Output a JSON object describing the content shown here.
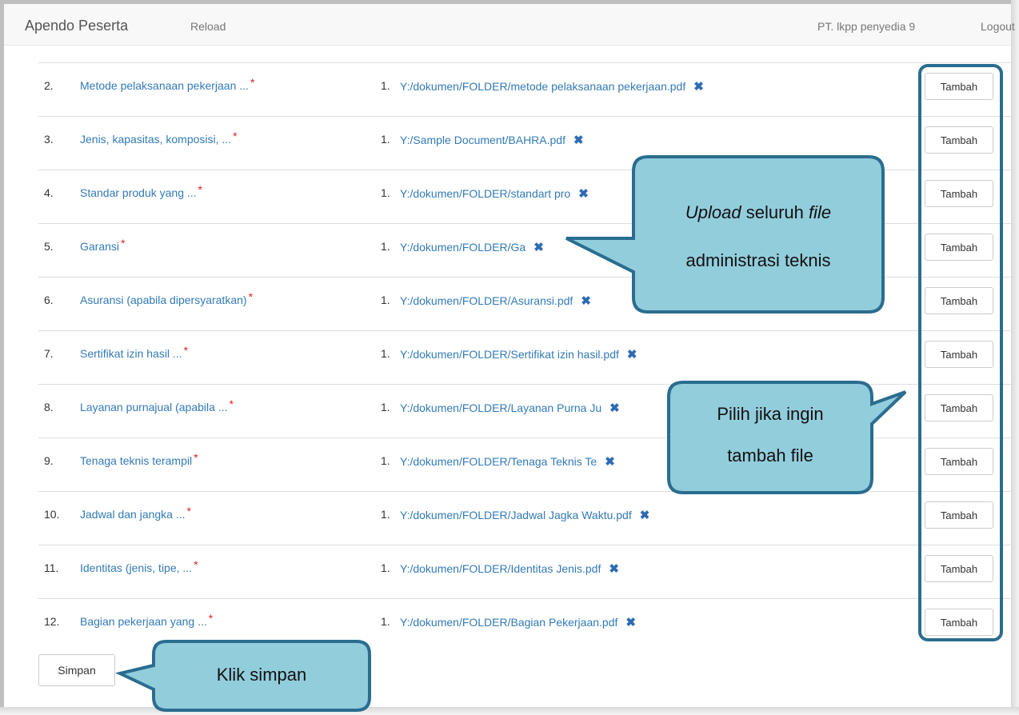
{
  "navbar": {
    "brand": "Apendo Peserta",
    "reload": "Reload",
    "user": "PT. lkpp penyedia 9",
    "logout": "Logout"
  },
  "rows": [
    {
      "num": "2.",
      "doc": "Metode pelaksanaan pekerjaan ...",
      "required": "*",
      "file_num": "1.",
      "file": "Y:/dokumen/FOLDER/metode pelaksanaan pekerjaan.pdf",
      "button": "Tambah"
    },
    {
      "num": "3.",
      "doc": "Jenis, kapasitas, komposisi, ...",
      "required": "*",
      "file_num": "1.",
      "file": "Y:/Sample Document/BAHRA.pdf",
      "button": "Tambah"
    },
    {
      "num": "4.",
      "doc": "Standar produk yang ...",
      "required": "*",
      "file_num": "1.",
      "file": "Y:/dokumen/FOLDER/standart pro",
      "button": "Tambah"
    },
    {
      "num": "5.",
      "doc": "Garansi",
      "required": "*",
      "file_num": "1.",
      "file": "Y:/dokumen/FOLDER/Ga",
      "button": "Tambah"
    },
    {
      "num": "6.",
      "doc": "Asuransi (apabila dipersyaratkan)",
      "required": "*",
      "file_num": "1.",
      "file": "Y:/dokumen/FOLDER/Asuransi.pdf",
      "button": "Tambah"
    },
    {
      "num": "7.",
      "doc": "Sertifikat izin hasil ...",
      "required": "*",
      "file_num": "1.",
      "file": "Y:/dokumen/FOLDER/Sertifikat izin hasil.pdf",
      "button": "Tambah"
    },
    {
      "num": "8.",
      "doc": "Layanan purnajual (apabila ...",
      "required": "*",
      "file_num": "1.",
      "file": "Y:/dokumen/FOLDER/Layanan Purna Ju",
      "button": "Tambah"
    },
    {
      "num": "9.",
      "doc": "Tenaga teknis terampil",
      "required": "*",
      "file_num": "1.",
      "file": "Y:/dokumen/FOLDER/Tenaga Teknis Te",
      "button": "Tambah"
    },
    {
      "num": "10.",
      "doc": "Jadwal dan jangka ...",
      "required": "*",
      "file_num": "1.",
      "file": "Y:/dokumen/FOLDER/Jadwal Jagka Waktu.pdf",
      "button": "Tambah"
    },
    {
      "num": "11.",
      "doc": "Identitas (jenis, tipe, ...",
      "required": "*",
      "file_num": "1.",
      "file": "Y:/dokumen/FOLDER/Identitas Jenis.pdf",
      "button": "Tambah"
    },
    {
      "num": "12.",
      "doc": "Bagian pekerjaan yang ...",
      "required": "*",
      "file_num": "1.",
      "file": "Y:/dokumen/FOLDER/Bagian Pekerjaan.pdf",
      "button": "Tambah"
    }
  ],
  "save_button": "Simpan",
  "callouts": {
    "upload_italic_1": "Upload",
    "upload_mid": " seluruh ",
    "upload_italic_2": "file",
    "upload_line2": "administrasi teknis",
    "tambah_line1": "Pilih jika ingin",
    "tambah_line2": "tambah file",
    "simpan": "Klik simpan"
  },
  "colors": {
    "link": "#337ab7",
    "required": "#e02020",
    "callout_fill": "#92cddc",
    "callout_border": "#2a6d8f"
  }
}
